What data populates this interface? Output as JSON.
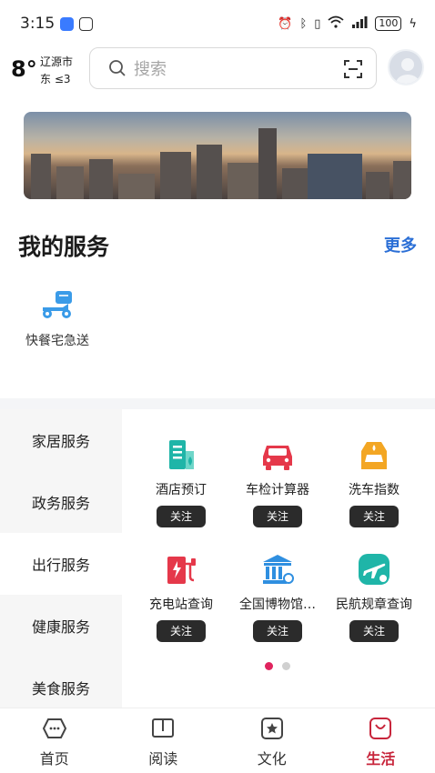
{
  "status_bar": {
    "time": "3:15",
    "battery": "100"
  },
  "header": {
    "temperature": "8°",
    "city": "辽源市",
    "wind": "东 ≤3",
    "search_placeholder": "搜索"
  },
  "my_services": {
    "title": "我的服务",
    "more_label": "更多",
    "items": [
      {
        "label": "快餐宅急送",
        "icon": "scooter-icon",
        "color": "#3a9be8"
      }
    ]
  },
  "categories": [
    {
      "label": "家居服务",
      "active": false
    },
    {
      "label": "政务服务",
      "active": false
    },
    {
      "label": "出行服务",
      "active": true
    },
    {
      "label": "健康服务",
      "active": false
    },
    {
      "label": "美食服务",
      "active": false
    }
  ],
  "services": [
    {
      "label": "酒店预订",
      "action": "关注",
      "icon": "hotel-icon",
      "color": "#1fb5a8"
    },
    {
      "label": "车检计算器",
      "action": "关注",
      "icon": "car-icon",
      "color": "#e5384a"
    },
    {
      "label": "洗车指数",
      "action": "关注",
      "icon": "car-wash-icon",
      "color": "#f3a623"
    },
    {
      "label": "充电站查询",
      "action": "关注",
      "icon": "charging-station-icon",
      "color": "#e5384a"
    },
    {
      "label": "全国博物馆…",
      "action": "关注",
      "icon": "museum-icon",
      "color": "#2f8fe0"
    },
    {
      "label": "民航规章查询",
      "action": "关注",
      "icon": "airplane-icon",
      "color": "#1fb5a8"
    }
  ],
  "pagination": {
    "current": 1,
    "total": 2
  },
  "bottom_nav": [
    {
      "label": "首页",
      "icon": "home-icon",
      "active": false
    },
    {
      "label": "阅读",
      "icon": "book-icon",
      "active": false
    },
    {
      "label": "文化",
      "icon": "star-icon",
      "active": false
    },
    {
      "label": "生活",
      "icon": "smile-bag-icon",
      "active": true
    }
  ],
  "colors": {
    "accent": "#c8263c",
    "link": "#2b6fd6",
    "page_indicator": "#e0245e"
  }
}
